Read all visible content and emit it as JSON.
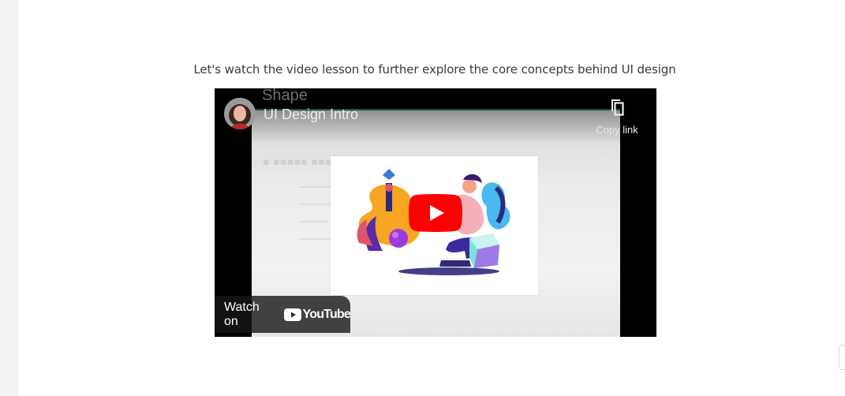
{
  "lesson": {
    "intro_text": "Let's watch the video lesson to further explore the core concepts behind UI design"
  },
  "video": {
    "title": "UI Design Intro",
    "background_heading": "Shape",
    "copy_link_label": "Copy link",
    "watch_on_label": "Watch on",
    "youtube_wordmark": "YouTube",
    "icons": {
      "copy": "copy-icon",
      "play": "play-icon",
      "youtube": "youtube-logo-icon"
    },
    "colors": {
      "play_red": "#ff0000",
      "slide_border": "#2f7d4b"
    }
  }
}
